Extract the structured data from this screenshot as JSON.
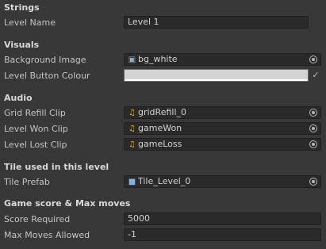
{
  "sections": {
    "strings": "Strings",
    "visuals": "Visuals",
    "audio": "Audio",
    "tile": "Tile used in this level",
    "score": "Game score & Max moves"
  },
  "fields": {
    "level_name": {
      "label": "Level Name",
      "value": "Level 1"
    },
    "background_image": {
      "label": "Background Image",
      "value": "bg_white",
      "icon": "sprite-icon"
    },
    "level_button_colour": {
      "label": "Level Button Colour",
      "value": "#d4d4d4"
    },
    "grid_refill_clip": {
      "label": "Grid Refill Clip",
      "value": "gridRefill_0",
      "icon": "audio-clip-icon"
    },
    "level_won_clip": {
      "label": "Level Won Clip",
      "value": "gameWon",
      "icon": "audio-clip-icon"
    },
    "level_lost_clip": {
      "label": "Level Lost Clip",
      "value": "gameLoss",
      "icon": "audio-clip-icon"
    },
    "tile_prefab": {
      "label": "Tile Prefab",
      "value": "Tile_Level_0",
      "icon": "prefab-icon"
    },
    "score_required": {
      "label": "Score Required",
      "value": "5000"
    },
    "max_moves": {
      "label": "Max Moves Allowed",
      "value": "-1"
    }
  },
  "colors": {
    "background": "#383838",
    "field_bg": "#2a2a2a",
    "audio_icon": "#f5b400"
  }
}
